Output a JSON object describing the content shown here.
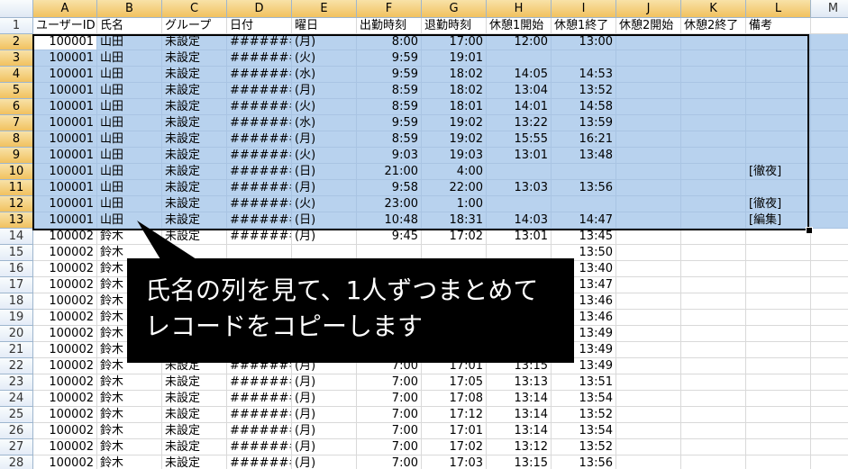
{
  "columns": [
    "A",
    "B",
    "C",
    "D",
    "E",
    "F",
    "G",
    "H",
    "I",
    "J",
    "K",
    "L",
    "M"
  ],
  "header_row": {
    "row": "1",
    "cells": [
      "ユーザーID",
      "氏名",
      "グループ",
      "日付",
      "曜日",
      "出勤時刻",
      "退勤時刻",
      "休憩1開始",
      "休憩1終了",
      "休憩2開始",
      "休憩2終了",
      "備考",
      ""
    ]
  },
  "rows": [
    {
      "row": "2",
      "cells": [
        "100001",
        "山田",
        "未設定",
        "########",
        "(月)",
        "8:00",
        "17:00",
        "12:00",
        "13:00",
        "",
        "",
        ""
      ]
    },
    {
      "row": "3",
      "cells": [
        "100001",
        "山田",
        "未設定",
        "########",
        "(火)",
        "9:59",
        "19:01",
        "",
        "",
        "",
        "",
        ""
      ]
    },
    {
      "row": "4",
      "cells": [
        "100001",
        "山田",
        "未設定",
        "########",
        "(水)",
        "9:59",
        "18:02",
        "14:05",
        "14:53",
        "",
        "",
        ""
      ]
    },
    {
      "row": "5",
      "cells": [
        "100001",
        "山田",
        "未設定",
        "########",
        "(月)",
        "8:59",
        "18:02",
        "13:04",
        "13:52",
        "",
        "",
        ""
      ]
    },
    {
      "row": "6",
      "cells": [
        "100001",
        "山田",
        "未設定",
        "########",
        "(火)",
        "8:59",
        "18:01",
        "14:01",
        "14:58",
        "",
        "",
        ""
      ]
    },
    {
      "row": "7",
      "cells": [
        "100001",
        "山田",
        "未設定",
        "########",
        "(水)",
        "9:59",
        "19:02",
        "13:22",
        "13:59",
        "",
        "",
        ""
      ]
    },
    {
      "row": "8",
      "cells": [
        "100001",
        "山田",
        "未設定",
        "########",
        "(月)",
        "8:59",
        "19:02",
        "15:55",
        "16:21",
        "",
        "",
        ""
      ]
    },
    {
      "row": "9",
      "cells": [
        "100001",
        "山田",
        "未設定",
        "########",
        "(火)",
        "9:03",
        "19:03",
        "13:01",
        "13:48",
        "",
        "",
        ""
      ]
    },
    {
      "row": "10",
      "cells": [
        "100001",
        "山田",
        "未設定",
        "########",
        "(日)",
        "21:00",
        "4:00",
        "",
        "",
        "",
        "",
        "[徹夜]"
      ]
    },
    {
      "row": "11",
      "cells": [
        "100001",
        "山田",
        "未設定",
        "########",
        "(月)",
        "9:58",
        "22:00",
        "13:03",
        "13:56",
        "",
        "",
        ""
      ]
    },
    {
      "row": "12",
      "cells": [
        "100001",
        "山田",
        "未設定",
        "########",
        "(火)",
        "23:00",
        "1:00",
        "",
        "",
        "",
        "",
        "[徹夜]"
      ]
    },
    {
      "row": "13",
      "cells": [
        "100001",
        "山田",
        "未設定",
        "########",
        "(日)",
        "10:48",
        "18:31",
        "14:03",
        "14:47",
        "",
        "",
        "[編集]"
      ]
    },
    {
      "row": "14",
      "cells": [
        "100002",
        "鈴木",
        "未設定",
        "########",
        "(月)",
        "9:45",
        "17:02",
        "13:01",
        "13:45",
        "",
        "",
        ""
      ]
    },
    {
      "row": "15",
      "cells": [
        "100002",
        "鈴木",
        "",
        "",
        "",
        "",
        "",
        "",
        "13:50",
        "",
        "",
        ""
      ]
    },
    {
      "row": "16",
      "cells": [
        "100002",
        "鈴木",
        "",
        "",
        "",
        "",
        "",
        "",
        "13:40",
        "",
        "",
        ""
      ]
    },
    {
      "row": "17",
      "cells": [
        "100002",
        "鈴木",
        "",
        "",
        "",
        "",
        "",
        "",
        "13:47",
        "",
        "",
        ""
      ]
    },
    {
      "row": "18",
      "cells": [
        "100002",
        "鈴木",
        "",
        "",
        "",
        "",
        "",
        "",
        "13:46",
        "",
        "",
        ""
      ]
    },
    {
      "row": "19",
      "cells": [
        "100002",
        "鈴木",
        "",
        "",
        "",
        "",
        "",
        "",
        "13:46",
        "",
        "",
        ""
      ]
    },
    {
      "row": "20",
      "cells": [
        "100002",
        "鈴木",
        "",
        "",
        "",
        "",
        "",
        "",
        "13:49",
        "",
        "",
        ""
      ]
    },
    {
      "row": "21",
      "cells": [
        "100002",
        "鈴木",
        "",
        "",
        "",
        "",
        "",
        "",
        "13:49",
        "",
        "",
        ""
      ]
    },
    {
      "row": "22",
      "cells": [
        "100002",
        "鈴木",
        "未設定",
        "########",
        "(月)",
        "7:00",
        "17:01",
        "13:15",
        "13:49",
        "",
        "",
        ""
      ]
    },
    {
      "row": "23",
      "cells": [
        "100002",
        "鈴木",
        "未設定",
        "########",
        "(月)",
        "7:00",
        "17:05",
        "13:13",
        "13:51",
        "",
        "",
        ""
      ]
    },
    {
      "row": "24",
      "cells": [
        "100002",
        "鈴木",
        "未設定",
        "########",
        "(月)",
        "7:00",
        "17:08",
        "13:14",
        "13:54",
        "",
        "",
        ""
      ]
    },
    {
      "row": "25",
      "cells": [
        "100002",
        "鈴木",
        "未設定",
        "########",
        "(月)",
        "7:00",
        "17:12",
        "13:14",
        "13:52",
        "",
        "",
        ""
      ]
    },
    {
      "row": "26",
      "cells": [
        "100002",
        "鈴木",
        "未設定",
        "########",
        "(月)",
        "7:00",
        "17:01",
        "13:14",
        "13:54",
        "",
        "",
        ""
      ]
    },
    {
      "row": "27",
      "cells": [
        "100002",
        "鈴木",
        "未設定",
        "########",
        "(月)",
        "7:00",
        "17:02",
        "13:12",
        "13:52",
        "",
        "",
        ""
      ]
    },
    {
      "row": "28",
      "cells": [
        "100002",
        "鈴木",
        "未設定",
        "########",
        "(月)",
        "7:00",
        "17:03",
        "13:15",
        "13:56",
        "",
        "",
        ""
      ]
    }
  ],
  "callout": {
    "line1": "氏名の列を見て、1人ずつまとめて",
    "line2": "レコードをコピーします"
  },
  "colors": {
    "selection_fill": "#b8d2ee",
    "header_highlight": "#f1c15f",
    "callout_bg": "#000000",
    "callout_text": "#ffffff"
  }
}
